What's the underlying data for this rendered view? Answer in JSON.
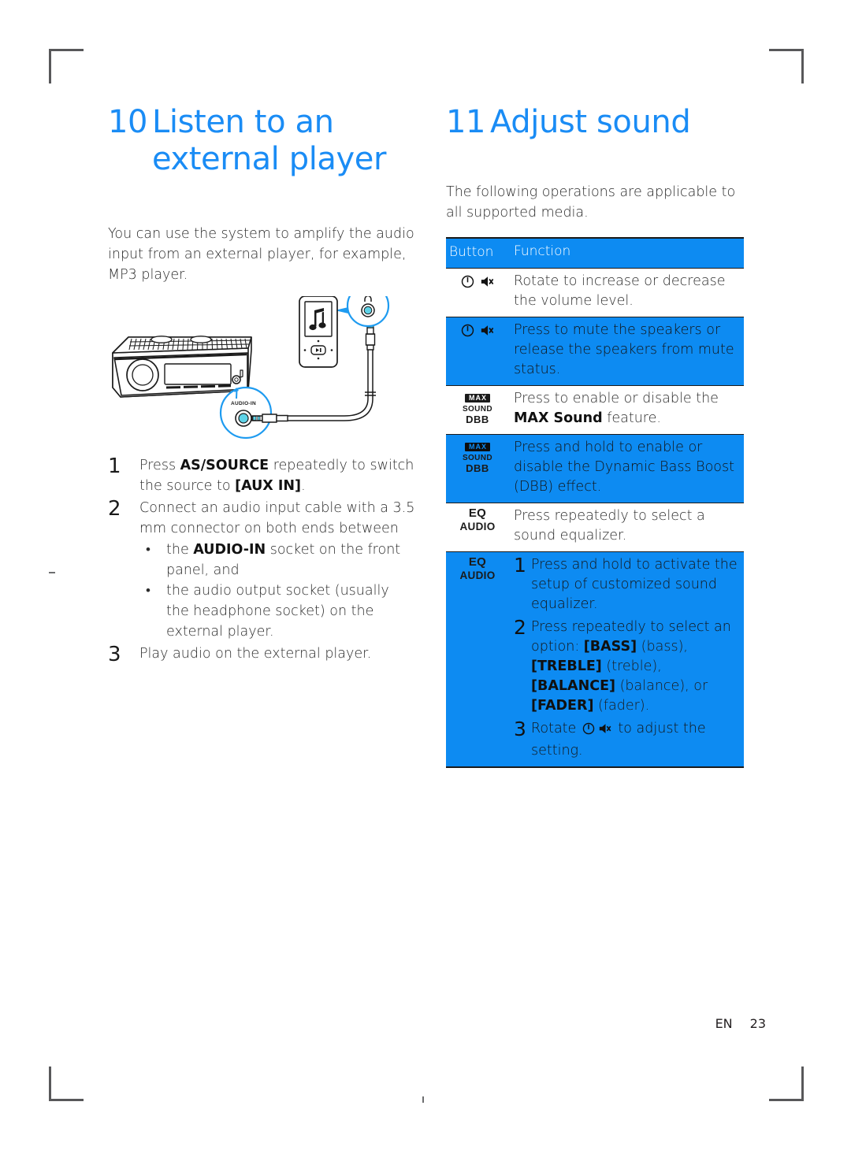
{
  "page": {
    "footer_language": "EN",
    "footer_number": "23",
    "accent_blue": "#1a8cf5",
    "highlight_blue": "#0d8bf2",
    "text_color": "#2b2b2b"
  },
  "left_column": {
    "chapter": {
      "number": "10",
      "title_line1": "Listen to an",
      "title_line2": "external player"
    },
    "intro": "You can use the system to amplify the audio input from an external player, for example, MP3 player.",
    "figure": {
      "name": "aux-in-connection-diagram",
      "caption_audio_in": "AUDIO-IN",
      "devices": [
        "car-stereo-head-unit",
        "mp3-player",
        "audio-cable-3.5mm"
      ]
    },
    "steps": [
      {
        "number": "1",
        "parts": [
          {
            "text": "Press ",
            "bold": false
          },
          {
            "text": "AS/SOURCE",
            "bold": true
          },
          {
            "text": " repeatedly to switch the source to ",
            "bold": false
          },
          {
            "text": "[AUX IN]",
            "bold": true
          },
          {
            "text": ".",
            "bold": false
          }
        ]
      },
      {
        "number": "2",
        "parts": [
          {
            "text": "Connect an audio input cable with a 3.5 mm connector on both ends between",
            "bold": false
          }
        ],
        "bullets": [
          [
            {
              "text": "the ",
              "bold": false
            },
            {
              "text": "AUDIO-IN",
              "bold": true
            },
            {
              "text": " socket on the front panel, and",
              "bold": false
            }
          ],
          [
            {
              "text": "the audio output socket (usually the headphone socket) on the external player.",
              "bold": false
            }
          ]
        ]
      },
      {
        "number": "3",
        "parts": [
          {
            "text": "Play audio on the external player.",
            "bold": false
          }
        ]
      }
    ]
  },
  "right_column": {
    "chapter": {
      "number": "11",
      "title_line1": "Adjust sound"
    },
    "intro": "The following operations are applicable to all supported media.",
    "table": {
      "headers": {
        "button": "Button",
        "function": "Function"
      },
      "rows": [
        {
          "button_icon": "power-mute-knob",
          "highlighted": false,
          "function_parts": [
            {
              "text": "Rotate to increase or decrease the volume level.",
              "style": "normal"
            }
          ]
        },
        {
          "button_icon": "power-mute-knob",
          "highlighted": true,
          "function_parts": [
            {
              "text": "Press to mute the speakers or release the speakers from mute status.",
              "style": "normal"
            }
          ]
        },
        {
          "button_icon": "max-sound-dbb",
          "button_label_max": "MAX",
          "button_label_sound": "SOUND",
          "button_label_dbb": "DBB",
          "highlighted": false,
          "function_parts": [
            {
              "text": "Press to enable or disable the ",
              "style": "normal"
            },
            {
              "text": "MAX Sound",
              "style": "bold"
            },
            {
              "text": " feature.",
              "style": "normal"
            }
          ]
        },
        {
          "button_icon": "max-sound-dbb",
          "button_label_max": "MAX",
          "button_label_sound": "SOUND",
          "button_label_dbb": "DBB",
          "highlighted": true,
          "function_parts": [
            {
              "text": "Press and hold to enable or disable the Dynamic Bass Boost (DBB) effect.",
              "style": "normal"
            }
          ]
        },
        {
          "button_icon": "eq-audio",
          "button_label_eq": "EQ",
          "button_label_audio": "AUDIO",
          "highlighted": false,
          "function_parts": [
            {
              "text": "Press repeatedly to select a sound equalizer.",
              "style": "normal"
            }
          ]
        },
        {
          "button_icon": "eq-audio",
          "button_label_eq": "EQ",
          "button_label_audio": "AUDIO",
          "highlighted": true,
          "inner_steps": [
            {
              "number": "1",
              "parts": [
                {
                  "text": "Press and hold to activate the setup of customized sound equalizer.",
                  "style": "normal"
                }
              ]
            },
            {
              "number": "2",
              "parts": [
                {
                  "text": "Press repeatedly to select an option: ",
                  "style": "normal"
                },
                {
                  "text": "[BASS]",
                  "style": "bold"
                },
                {
                  "text": " (bass), ",
                  "style": "light"
                },
                {
                  "text": "[TREBLE]",
                  "style": "bold"
                },
                {
                  "text": " (treble), ",
                  "style": "light"
                },
                {
                  "text": "[BALANCE]",
                  "style": "bold"
                },
                {
                  "text": " (balance), or ",
                  "style": "light"
                },
                {
                  "text": "[FADER]",
                  "style": "bold"
                },
                {
                  "text": " (fader).",
                  "style": "light"
                }
              ]
            },
            {
              "number": "3",
              "parts_before_icons": "Rotate ",
              "parts_after_icons": " to adjust the setting."
            }
          ]
        }
      ]
    }
  }
}
